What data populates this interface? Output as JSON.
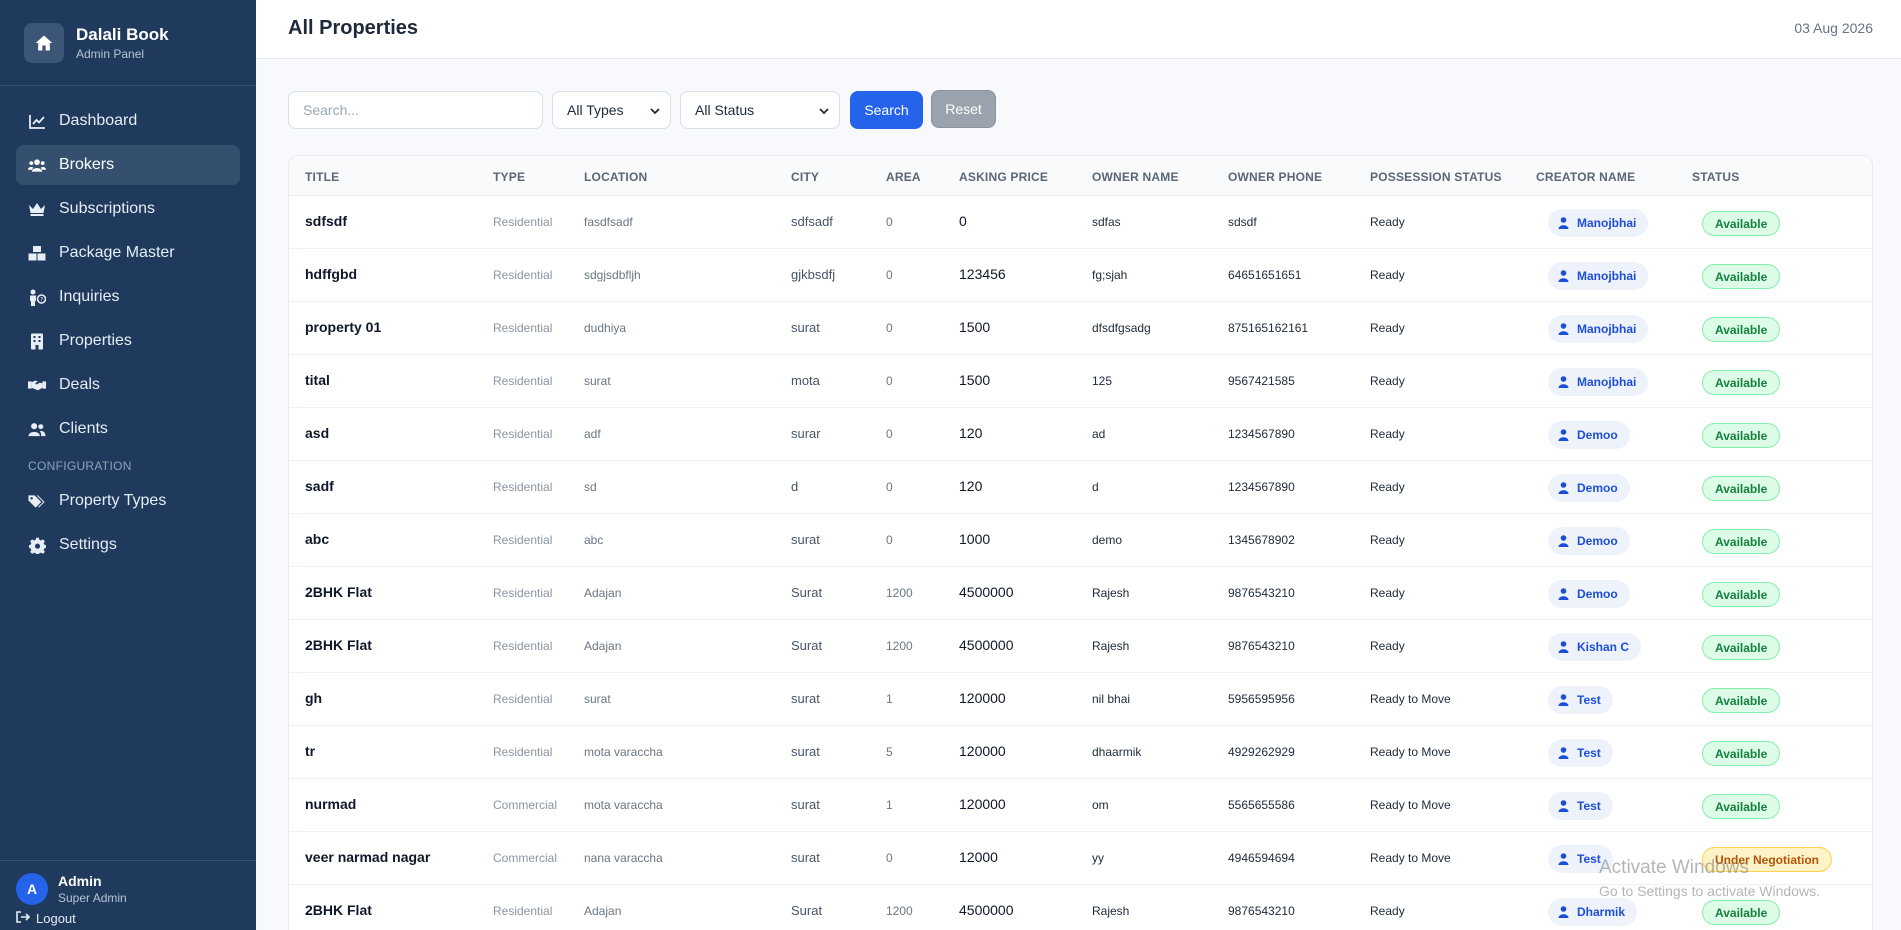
{
  "brand": {
    "title": "Dalali Book",
    "subtitle": "Admin Panel"
  },
  "nav": {
    "items": [
      {
        "label": "Dashboard",
        "icon": "chart-line-icon"
      },
      {
        "label": "Brokers",
        "icon": "users-icon",
        "active": true
      },
      {
        "label": "Subscriptions",
        "icon": "crown-icon"
      },
      {
        "label": "Package Master",
        "icon": "boxes-icon"
      },
      {
        "label": "Inquiries",
        "icon": "person-question-icon"
      },
      {
        "label": "Properties",
        "icon": "building-icon"
      },
      {
        "label": "Deals",
        "icon": "handshake-icon"
      },
      {
        "label": "Clients",
        "icon": "user-group-icon"
      }
    ],
    "section_label": "CONFIGURATION",
    "config_items": [
      {
        "label": "Property Types",
        "icon": "tags-icon"
      },
      {
        "label": "Settings",
        "icon": "gear-icon"
      }
    ]
  },
  "user": {
    "initial": "A",
    "name": "Admin",
    "role": "Super Admin",
    "logout_label": "Logout"
  },
  "header": {
    "title": "All Properties",
    "date": "03 Aug 2026"
  },
  "filters": {
    "search_placeholder": "Search...",
    "type_value": "All Types",
    "status_value": "All Status",
    "search_label": "Search",
    "reset_label": "Reset"
  },
  "table": {
    "columns": [
      "TITLE",
      "TYPE",
      "LOCATION",
      "CITY",
      "AREA",
      "ASKING PRICE",
      "OWNER NAME",
      "OWNER PHONE",
      "POSSESSION STATUS",
      "CREATOR NAME",
      "STATUS"
    ],
    "rows": [
      {
        "title": "sdfsdf",
        "type": "Residential",
        "location": "fasdfsadf",
        "city": "sdfsadf",
        "area": "0",
        "price": "0",
        "owner": "sdfas",
        "phone": "sdsdf",
        "possession": "Ready",
        "creator": "Manojbhai",
        "status": "Available"
      },
      {
        "title": "hdffgbd",
        "type": "Residential",
        "location": "sdgjsdbfljh",
        "city": "gjkbsdfj",
        "area": "0",
        "price": "123456",
        "owner": "fg;sjah",
        "phone": "64651651651",
        "possession": "Ready",
        "creator": "Manojbhai",
        "status": "Available"
      },
      {
        "title": "property 01",
        "type": "Residential",
        "location": "dudhiya",
        "city": "surat",
        "area": "0",
        "price": "1500",
        "owner": "dfsdfgsadg",
        "phone": "875165162161",
        "possession": "Ready",
        "creator": "Manojbhai",
        "status": "Available"
      },
      {
        "title": "tital",
        "type": "Residential",
        "location": "surat",
        "city": "mota",
        "area": "0",
        "price": "1500",
        "owner": "125",
        "phone": "9567421585",
        "possession": "Ready",
        "creator": "Manojbhai",
        "status": "Available"
      },
      {
        "title": "asd",
        "type": "Residential",
        "location": "adf",
        "city": "surar",
        "area": "0",
        "price": "120",
        "owner": "ad",
        "phone": "1234567890",
        "possession": "Ready",
        "creator": "Demoo",
        "status": "Available"
      },
      {
        "title": "sadf",
        "type": "Residential",
        "location": "sd",
        "city": "d",
        "area": "0",
        "price": "120",
        "owner": "d",
        "phone": "1234567890",
        "possession": "Ready",
        "creator": "Demoo",
        "status": "Available"
      },
      {
        "title": "abc",
        "type": "Residential",
        "location": "abc",
        "city": "surat",
        "area": "0",
        "price": "1000",
        "owner": "demo",
        "phone": "1345678902",
        "possession": "Ready",
        "creator": "Demoo",
        "status": "Available"
      },
      {
        "title": "2BHK Flat",
        "type": "Residential",
        "location": "Adajan",
        "city": "Surat",
        "area": "1200",
        "price": "4500000",
        "owner": "Rajesh",
        "phone": "9876543210",
        "possession": "Ready",
        "creator": "Demoo",
        "status": "Available"
      },
      {
        "title": "2BHK Flat",
        "type": "Residential",
        "location": "Adajan",
        "city": "Surat",
        "area": "1200",
        "price": "4500000",
        "owner": "Rajesh",
        "phone": "9876543210",
        "possession": "Ready",
        "creator": "Kishan C",
        "status": "Available"
      },
      {
        "title": "gh",
        "type": "Residential",
        "location": "surat",
        "city": "surat",
        "area": "1",
        "price": "120000",
        "owner": "nil bhai",
        "phone": "5956595956",
        "possession": "Ready to Move",
        "creator": "Test",
        "status": "Available"
      },
      {
        "title": "tr",
        "type": "Residential",
        "location": "mota varaccha",
        "city": "surat",
        "area": "5",
        "price": "120000",
        "owner": "dhaarmik",
        "phone": "4929262929",
        "possession": "Ready to Move",
        "creator": "Test",
        "status": "Available"
      },
      {
        "title": "nurmad",
        "type": "Commercial",
        "location": "mota varaccha",
        "city": "surat",
        "area": "1",
        "price": "120000",
        "owner": "om",
        "phone": "5565655586",
        "possession": "Ready to Move",
        "creator": "Test",
        "status": "Available"
      },
      {
        "title": "veer narmad nagar",
        "type": "Commercial",
        "location": "nana varaccha",
        "city": "surat",
        "area": "0",
        "price": "12000",
        "owner": "yy",
        "phone": "4946594694",
        "possession": "Ready to Move",
        "creator": "Test",
        "status": "Under Negotiation"
      },
      {
        "title": "2BHK Flat",
        "type": "Residential",
        "location": "Adajan",
        "city": "Surat",
        "area": "1200",
        "price": "4500000",
        "owner": "Rajesh",
        "phone": "9876543210",
        "possession": "Ready",
        "creator": "Dharmik",
        "status": "Available"
      }
    ]
  },
  "watermark": {
    "title": "Activate Windows",
    "subtitle": "Go to Settings to activate Windows."
  },
  "colors": {
    "sidebar": "#1f3a5c",
    "accent": "#2563eb",
    "available": "#15803d",
    "negotiation": "#b45309"
  }
}
